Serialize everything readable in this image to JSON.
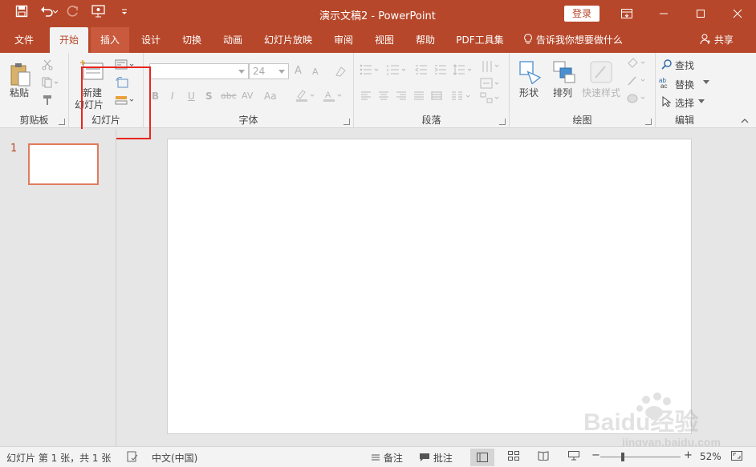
{
  "titlebar": {
    "title": "演示文稿2  -  PowerPoint",
    "login": "登录"
  },
  "tabs": [
    "文件",
    "开始",
    "插入",
    "设计",
    "切换",
    "动画",
    "幻灯片放映",
    "审阅",
    "视图",
    "帮助",
    "PDF工具集"
  ],
  "tellme": "告诉我你想要做什么",
  "share": "共享",
  "ribbon": {
    "clipboard": {
      "paste": "粘贴",
      "group": "剪贴板"
    },
    "slides": {
      "new_slide_line1": "新建",
      "new_slide_line2": "幻灯片",
      "group": "幻灯片"
    },
    "font": {
      "size": "24",
      "group": "字体",
      "bold": "B",
      "italic": "I",
      "underline": "U",
      "shadow": "S",
      "strike": "abc",
      "spacing": "AV",
      "case": "Aa",
      "grow": "A",
      "shrink": "A"
    },
    "paragraph": {
      "group": "段落"
    },
    "drawing": {
      "shapes": "形状",
      "arrange": "排列",
      "quick_styles": "快速样式",
      "group": "绘图"
    },
    "editing": {
      "find": "查找",
      "replace": "替换",
      "select": "选择",
      "group": "编辑"
    }
  },
  "thumbnail": {
    "number": "1"
  },
  "statusbar": {
    "slide_info": "幻灯片 第 1 张，共 1 张",
    "language": "中文(中国)",
    "notes": "备注",
    "comments": "批注",
    "zoom": "52%"
  },
  "watermark": {
    "brand": "Baidu经验",
    "url": "jingyan.baidu.com"
  },
  "colors": {
    "accent": "#b7472a",
    "highlight": "#e8251f"
  }
}
